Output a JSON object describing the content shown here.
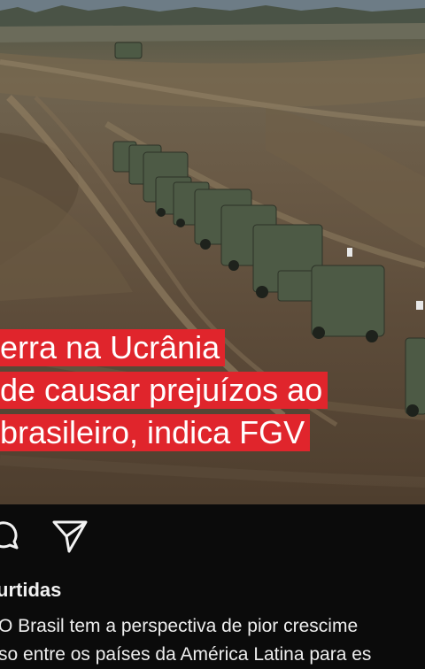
{
  "post": {
    "headline_lines": [
      "erra na Ucrânia",
      "de causar prejuízos ao",
      " brasileiro, indica FGV"
    ],
    "headline_bg": "#e0252c",
    "shares_label": "urtidas",
    "caption_lines": [
      " O Brasil tem a perspectiva de pior crescime",
      "so entre os países da América Latina para es"
    ]
  },
  "icons": {
    "comment": "comment-icon",
    "share": "share-icon"
  }
}
